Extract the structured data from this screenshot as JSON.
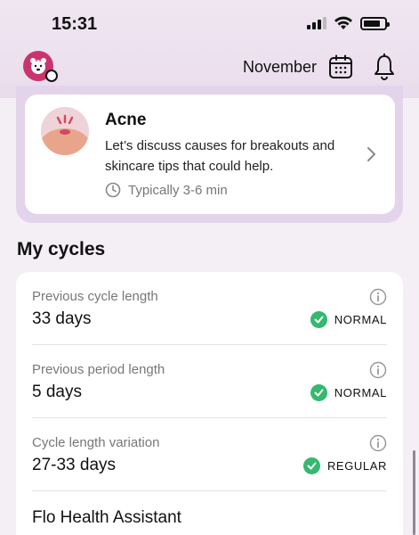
{
  "status_bar": {
    "time": "15:31"
  },
  "header": {
    "month": "November"
  },
  "article": {
    "title": "Acne",
    "description": "Let’s discuss causes for breakouts and skincare tips that could help.",
    "duration": "Typically 3-6 min"
  },
  "cycles": {
    "section_title": "My cycles",
    "rows": [
      {
        "label": "Previous cycle length",
        "value": "33 days",
        "status": "NORMAL"
      },
      {
        "label": "Previous period length",
        "value": "5 days",
        "status": "NORMAL"
      },
      {
        "label": "Cycle length variation",
        "value": "27-33 days",
        "status": "REGULAR"
      }
    ],
    "assistant_title": "Flo Health Assistant"
  },
  "colors": {
    "accent": "#c9346f",
    "status_green": "#35b86f",
    "lavender": "#e3d4ec"
  },
  "icons": [
    "avatar-icon",
    "calendar-icon",
    "bell-icon",
    "clock-icon",
    "chevron-right-icon",
    "info-icon",
    "check-icon"
  ]
}
